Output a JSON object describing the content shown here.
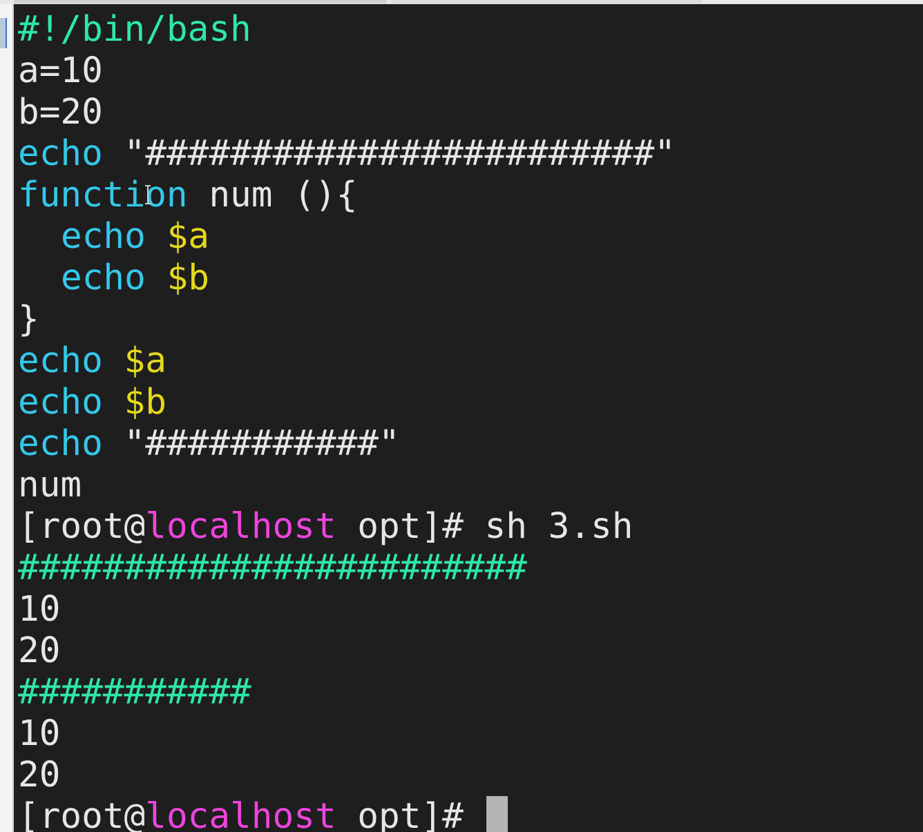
{
  "script": {
    "shebang": "#!/bin/bash",
    "line_a": "a=10",
    "line_b": "b=20",
    "echo_kw": "echo",
    "banner1_str": "\"########################\"",
    "function_kw": "function",
    "function_sig": " num (){",
    "var_a": "$a",
    "var_b": "$b",
    "close_brace": "}",
    "banner2_str": "\"###########\"",
    "call": "num"
  },
  "prompt": {
    "open": "[root@",
    "host": "localhost",
    "dir_part": " opt]# "
  },
  "command": "sh 3.sh",
  "output": {
    "banner1": "########################",
    "v1": "10",
    "v2": "20",
    "banner2": "###########",
    "v3": "10",
    "v4": "20"
  },
  "colors": {
    "background": "#1e1e1e",
    "shebang_green": "#2ee8a6",
    "keyword_cyan": "#34c8ea",
    "variable_yellow": "#e4d81e",
    "host_magenta": "#ee44dd",
    "text_white": "#e6e6e6"
  },
  "icons": {
    "cursor": "block-cursor",
    "mouse": "text-cursor-icon"
  }
}
